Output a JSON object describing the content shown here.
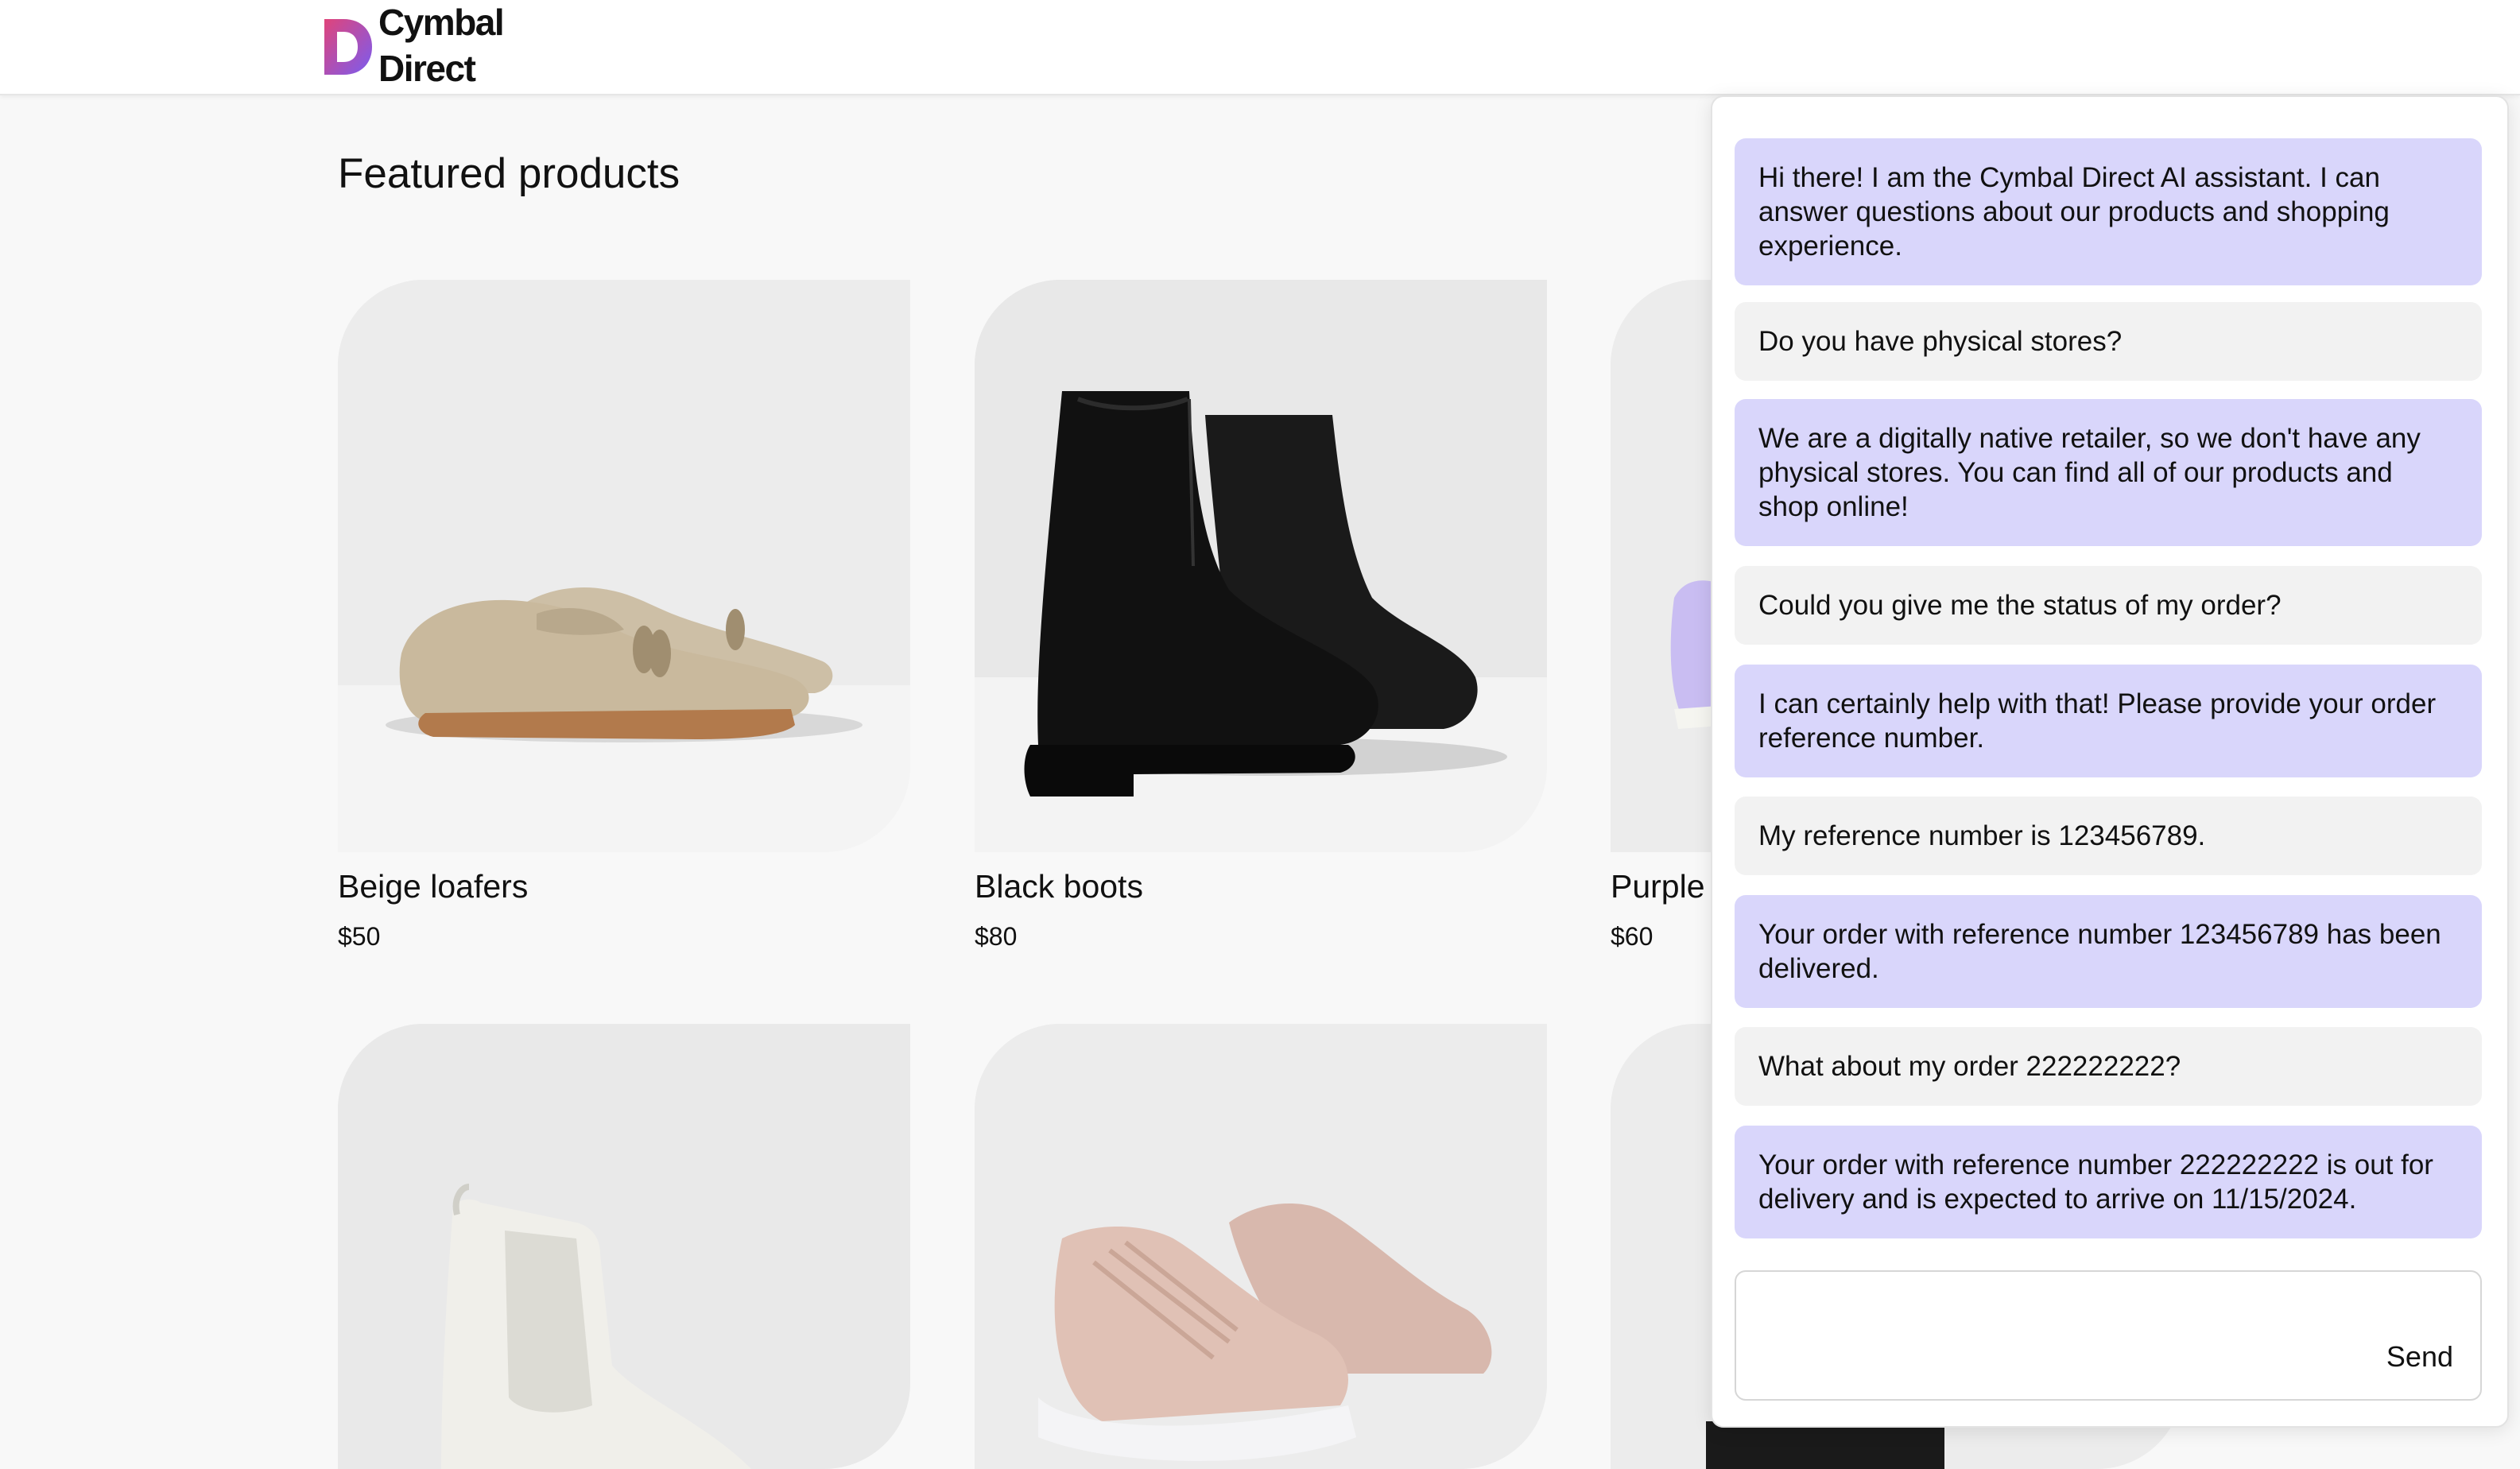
{
  "header": {
    "logo_line1": "Cymbal",
    "logo_line2": "Direct"
  },
  "main": {
    "title": "Featured products",
    "products": [
      {
        "name": "Beige loafers",
        "price": "$50"
      },
      {
        "name": "Black boots",
        "price": "$80"
      },
      {
        "name": "Purple",
        "price": "$60"
      }
    ]
  },
  "chat": {
    "messages": [
      {
        "role": "assistant",
        "text": "Hi there! I am the Cymbal Direct AI assistant. I can answer questions about our products and shopping experience."
      },
      {
        "role": "user",
        "text": "Do you have physical stores?"
      },
      {
        "role": "assistant",
        "text": "We are a digitally native retailer, so we don't have any physical stores. You can find all of our products and shop online!"
      },
      {
        "role": "user",
        "text": "Could you give me the status of my order?"
      },
      {
        "role": "assistant",
        "text": "I can certainly help with that! Please provide your order reference number."
      },
      {
        "role": "user",
        "text": "My reference number is 123456789."
      },
      {
        "role": "assistant",
        "text": "Your order with reference number 123456789 has been delivered."
      },
      {
        "role": "user",
        "text": "What about my order 222222222?"
      },
      {
        "role": "assistant",
        "text": "Your order with reference number 222222222 is out for delivery and is expected to arrive on 11/15/2024."
      }
    ],
    "input_value": "",
    "send_label": "Send"
  },
  "colors": {
    "assistant_bubble": "#d9d6fb",
    "user_bubble": "#f2f2f2",
    "logo_gradient_start": "#e0447a",
    "logo_gradient_end": "#7a5cf0"
  }
}
